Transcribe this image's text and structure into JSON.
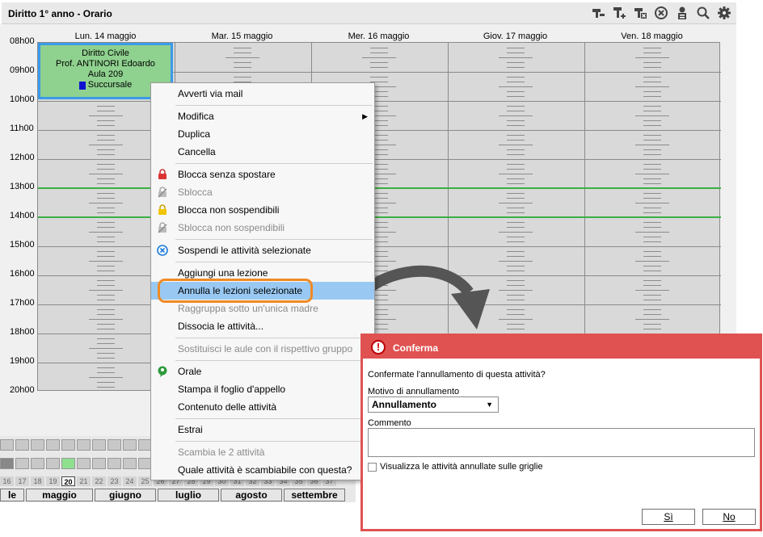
{
  "window": {
    "title": "Diritto 1° anno - Orario"
  },
  "toolbar_icons": [
    "lesson-remove-icon",
    "lesson-add-icon",
    "lesson-delete-icon",
    "cancel-circle-icon",
    "person-icon",
    "search-icon",
    "gear-icon"
  ],
  "hours": [
    "08h00",
    "09h00",
    "10h00",
    "11h00",
    "12h00",
    "13h00",
    "14h00",
    "15h00",
    "16h00",
    "17h00",
    "18h00",
    "19h00",
    "20h00"
  ],
  "days": [
    "Lun. 14 maggio",
    "Mar. 15 maggio",
    "Mer. 16 maggio",
    "Giov. 17 maggio",
    "Ven. 18 maggio"
  ],
  "lesson": {
    "subject": "Diritto Civile",
    "teacher": "Prof. ANTINORI Edoardo",
    "room": "Aula 209",
    "site": "Succursale",
    "site_color": "#1010d0",
    "bg_color": "#8fd18f",
    "selected_color": "#3b9be8"
  },
  "timeline": {
    "week_numbers": [
      "16",
      "17",
      "18",
      "19",
      "20",
      "21",
      "22",
      "23",
      "24",
      "25",
      "26",
      "27",
      "28",
      "29",
      "30",
      "31",
      "32",
      "33",
      "34",
      "35",
      "36",
      "37"
    ],
    "current_week": "20",
    "months": [
      "le",
      "maggio",
      "giugno",
      "luglio",
      "agosto",
      "settembre"
    ]
  },
  "context_menu": {
    "items": [
      {
        "label": "Avverti via mail",
        "disabled": false,
        "icon": ""
      },
      {
        "label": "Modifica",
        "disabled": false,
        "icon": "",
        "submenu": true
      },
      {
        "label": "Duplica",
        "disabled": false,
        "icon": ""
      },
      {
        "label": "Cancella",
        "disabled": false,
        "icon": ""
      },
      {
        "label": "Blocca senza spostare",
        "disabled": false,
        "icon": "lock-red-icon"
      },
      {
        "label": "Sblocca",
        "disabled": true,
        "icon": "unlock-icon"
      },
      {
        "label": "Blocca non sospendibili",
        "disabled": false,
        "icon": "lock-yellow-icon"
      },
      {
        "label": "Sblocca non sospendibili",
        "disabled": true,
        "icon": "unlock-icon"
      },
      {
        "label": "Sospendi le attività selezionate",
        "disabled": false,
        "icon": "suspend-icon"
      },
      {
        "label": "Aggiungi una lezione",
        "disabled": false,
        "icon": ""
      },
      {
        "label": "Annulla le lezioni selezionate",
        "disabled": false,
        "icon": "",
        "highlighted": true
      },
      {
        "label": "Raggruppa sotto un'unica madre",
        "disabled": true,
        "icon": ""
      },
      {
        "label": "Dissocia le attività...",
        "disabled": false,
        "icon": ""
      },
      {
        "label": "Sostituisci le aule con il rispettivo gruppo",
        "disabled": true,
        "icon": ""
      },
      {
        "label": "Orale",
        "disabled": false,
        "icon": "speech-bubble-icon"
      },
      {
        "label": "Stampa il foglio d'appello",
        "disabled": false,
        "icon": ""
      },
      {
        "label": "Contenuto delle attività",
        "disabled": false,
        "icon": ""
      },
      {
        "label": "Estrai",
        "disabled": false,
        "icon": ""
      },
      {
        "label": "Scambia le 2 attività",
        "disabled": true,
        "icon": ""
      },
      {
        "label": "Quale attività è scambiabile con questa?",
        "disabled": false,
        "icon": ""
      }
    ]
  },
  "dialog": {
    "title": "Conferma",
    "question": "Confermate l'annullamento di questa attività?",
    "reason_label": "Motivo di annullamento",
    "reason_value": "Annullamento",
    "comment_label": "Commento",
    "comment_value": "",
    "checkbox_label": "Visualizza le attività annullate sulle griglie",
    "checkbox_checked": false,
    "yes_label": "Sì",
    "no_label": "No"
  },
  "colors": {
    "accent_orange": "#f08a24",
    "dialog_red": "#e05252",
    "green_line": "#3cb043",
    "menu_highlight": "#99c9f3"
  }
}
